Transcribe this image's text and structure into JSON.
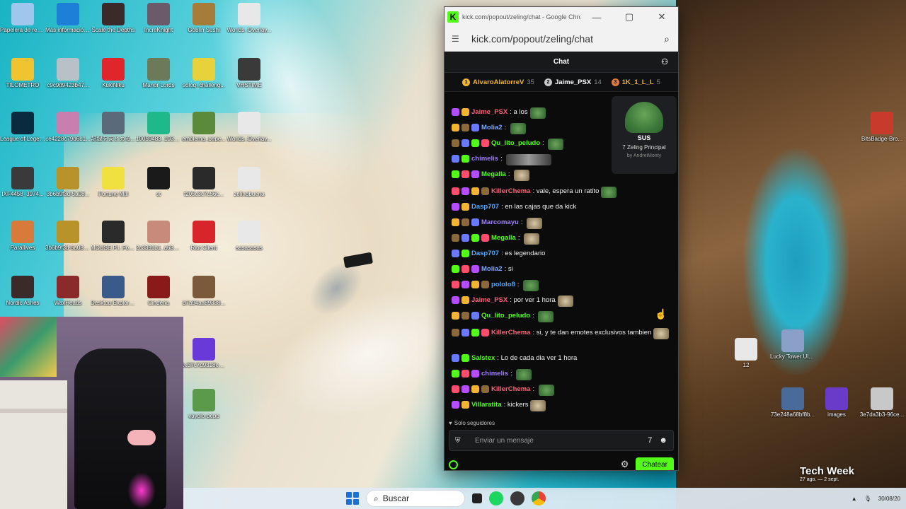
{
  "desktop": {
    "icons": [
      {
        "label": "Papelera de reciclaje",
        "color": "#9fc7ee"
      },
      {
        "label": "Más información sobre esta ima...",
        "color": "#1e7fd8"
      },
      {
        "label": "Scale the Depths",
        "color": "#3a2a2a"
      },
      {
        "label": "IncreKnight",
        "color": "#6b5a6a"
      },
      {
        "label": "Goblin Sushi",
        "color": "#a67c3b"
      },
      {
        "label": "Worlds_Overlay...",
        "color": "#e8e8e8"
      },
      {
        "label": "TILOMETRO",
        "color": "#f0c330"
      },
      {
        "label": "c9c9d9423b47...",
        "color": "#b8c0c8"
      },
      {
        "label": "KukiNiku",
        "color": "#e0252b"
      },
      {
        "label": "Manor Lords",
        "color": "#6d7a5a"
      },
      {
        "label": "soloq_challeng...",
        "color": "#e8d23b"
      },
      {
        "label": "VHSTIME",
        "color": "#3a3a3a"
      },
      {
        "label": "League of Legends",
        "color": "#0a2a40"
      },
      {
        "label": "ce4228c79d6b1...",
        "color": "#c87fb0"
      },
      {
        "label": "記録をまとめる...",
        "color": "#5a6a7a"
      },
      {
        "label": "10059483_1031...",
        "color": "#1db98a"
      },
      {
        "label": "emblema_pepe...",
        "color": "#5a8a3a"
      },
      {
        "label": "Worlds_Overlay...",
        "color": "#e8e8e8"
      },
      {
        "label": "IXF4458_3974...",
        "color": "#3a3a3a"
      },
      {
        "label": "3b6b9f3d-5a08...",
        "color": "#b8932a"
      },
      {
        "label": "Fortune Mill",
        "color": "#f0e040"
      },
      {
        "label": "st",
        "color": "#1a1a1a"
      },
      {
        "label": "f205c3c7c56c...",
        "color": "#2a2a2a"
      },
      {
        "label": "zelingbuena",
        "color": "#e8e8e8"
      },
      {
        "label": "Parallives",
        "color": "#d87a3a"
      },
      {
        "label": "3b6b9f3d-5a08... (1)",
        "color": "#b8932a"
      },
      {
        "label": "MOUSE P.I. For Hire",
        "color": "#2a2a2a"
      },
      {
        "label": "2c3391b1_a63b...",
        "color": "#c88a7a"
      },
      {
        "label": "Riot Client",
        "color": "#d8242b"
      },
      {
        "label": "sasasasas",
        "color": "#e8e8e8"
      },
      {
        "label": "Nordic Ashes",
        "color": "#3a2a2a"
      },
      {
        "label": "WaxHeads",
        "color": "#8a2a2a"
      },
      {
        "label": "Desktop Explorer Demo",
        "color": "#3a5a8a"
      },
      {
        "label": "Cinderia",
        "color": "#8a1a1a"
      },
      {
        "label": "b7a94aa89338...",
        "color": "#7a5a3a"
      },
      {
        "label": "1e57c7d9318e4...",
        "color": "#6a3ad8"
      },
      {
        "label": "vayolo-pepo",
        "color": "#5a9a4a"
      },
      {
        "label": "BitsBadge-Bro...",
        "color": "#c83a2a"
      },
      {
        "label": "12",
        "color": "#e8e8e8"
      },
      {
        "label": "Lucky Tower Ultimate",
        "color": "#8aa0c8"
      },
      {
        "label": "73e248a68bf8b...",
        "color": "#4a6a9a"
      },
      {
        "label": "images",
        "color": "#6a3ac8"
      },
      {
        "label": "3e7da3b3-96ce...",
        "color": "#c8c8c8"
      }
    ]
  },
  "taskbar": {
    "search_placeholder": "Buscar",
    "tray_time": "30/08/20"
  },
  "overlay": {
    "tech_week": "Tech Week",
    "tech_week_dates": "27 ago. — 2 sept."
  },
  "browser": {
    "title": "kick.com/popout/zeling/chat - Google Chro...",
    "url": "kick.com/popout/zeling/chat",
    "logo": "K"
  },
  "chat": {
    "header": "Chat",
    "leaderboard": [
      {
        "rank": "1",
        "name": "AlvaroAlatorreV",
        "count": "35",
        "color": "#f2b531",
        "name_color": "#f2b531"
      },
      {
        "rank": "2",
        "name": "Jaime_PSX",
        "count": "14",
        "color": "#c8c8c8",
        "name_color": "#ffffff"
      },
      {
        "rank": "3",
        "name": "1K_1_L_L",
        "count": "5",
        "color": "#e07a3a",
        "name_color": "#f2b531"
      }
    ],
    "pinned_emote": {
      "name": "SUS",
      "source": "Zeling Principal",
      "by": "by AndreiMonty"
    },
    "messages": [
      {
        "user": "Jaime_PSX",
        "user_color": "#ff5f76",
        "text": "a los",
        "emote": "pepe"
      },
      {
        "user": "Molia2",
        "user_color": "#7aa8ff",
        "text": "",
        "emote": "pepe"
      },
      {
        "user": "Qu_lito_peludo",
        "user_color": "#53fc18",
        "text": "",
        "emote": "pepe"
      },
      {
        "user": "chimelis",
        "user_color": "#9f7fff",
        "text": "",
        "emote": "wide"
      },
      {
        "user": "Megalla",
        "user_color": "#53fc18",
        "text": "",
        "emote": "cat"
      },
      {
        "user": "KillerChema",
        "user_color": "#ff5f76",
        "text": "vale, espera un ratito",
        "emote": "pepe"
      },
      {
        "user": "Dasp707",
        "user_color": "#4ea8ff",
        "text": "en las cajas que da kick",
        "emote": ""
      },
      {
        "user": "Marcomayu",
        "user_color": "#9f7fff",
        "text": "",
        "emote": "cat"
      },
      {
        "user": "Megalla",
        "user_color": "#53fc18",
        "text": "",
        "emote": "cat"
      },
      {
        "user": "Dasp707",
        "user_color": "#4ea8ff",
        "text": "es legendario",
        "emote": ""
      },
      {
        "user": "Molia2",
        "user_color": "#7aa8ff",
        "text": "si",
        "emote": ""
      },
      {
        "user": "pololo8",
        "user_color": "#4ea8ff",
        "text": "",
        "emote": "pepe"
      },
      {
        "user": "Jaime_PSX",
        "user_color": "#ff5f76",
        "text": "por ver 1 hora",
        "emote": "cat"
      },
      {
        "user": "Qu_lito_peludo",
        "user_color": "#53fc18",
        "text": "",
        "emote": "pepe"
      },
      {
        "user": "KillerChema",
        "user_color": "#ff5f76",
        "text": "si, y te dan emotes exclusivos tambien",
        "emote": "cat"
      },
      {
        "user": "Salstex",
        "user_color": "#53fc18",
        "text": "Lo de cada dia ver 1 hora",
        "emote": ""
      },
      {
        "user": "chimelis",
        "user_color": "#9f7fff",
        "text": "",
        "emote": "pepe"
      },
      {
        "user": "KillerChema",
        "user_color": "#ff5f76",
        "text": "",
        "emote": "pepe"
      },
      {
        "user": "Villaratita",
        "user_color": "#53fc18",
        "text": "kickers",
        "emote": "cat"
      }
    ],
    "followers_only": "Solo seguidores",
    "input_placeholder": "Enviar un mensaje",
    "send_button": "Chatear"
  },
  "colors": {
    "kick_green": "#53fc18",
    "chat_bg": "#0b0b0c"
  }
}
